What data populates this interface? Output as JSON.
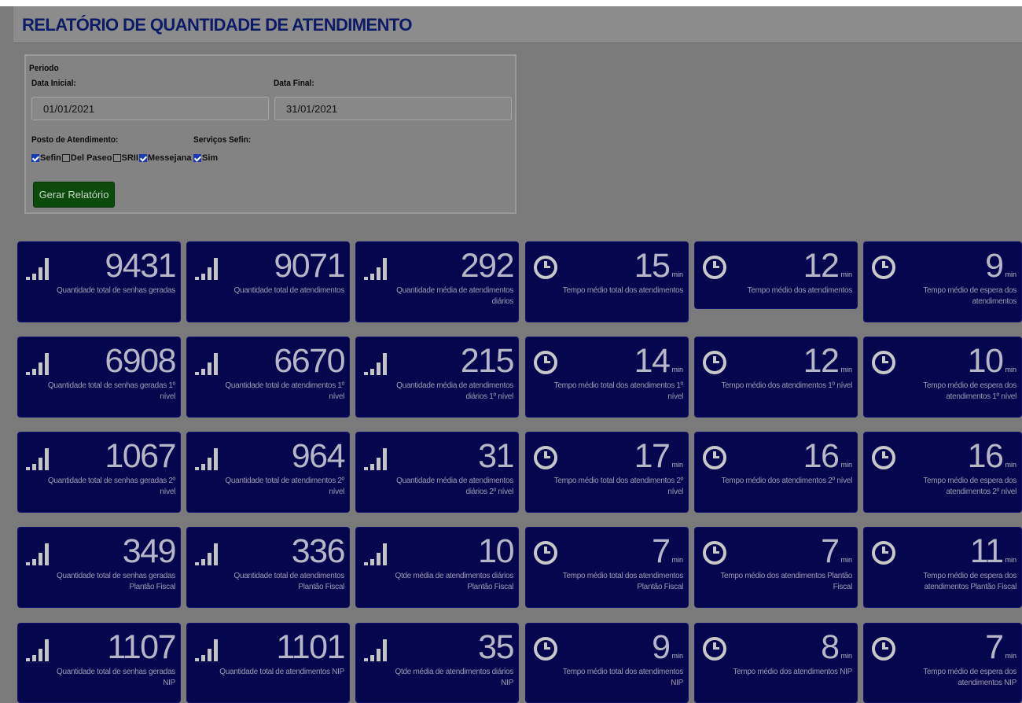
{
  "title": "RELATÓRIO DE QUANTIDADE DE ATENDIMENTO",
  "filters": {
    "period_label": "Periodo",
    "start_label": "Data Inicial:",
    "start_value": "01/01/2021",
    "end_label": "Data Final:",
    "end_value": "31/01/2021",
    "posto_label": "Posto de Atendimento:",
    "postos": [
      {
        "label": "Sefin",
        "checked": true
      },
      {
        "label": "Del Paseo",
        "checked": false
      },
      {
        "label": "SRII",
        "checked": false
      },
      {
        "label": "Messejana",
        "checked": true
      }
    ],
    "servicos_label": "Serviços Sefin:",
    "servicos": [
      {
        "label": "Sim",
        "checked": true
      }
    ],
    "submit_label": "Gerar Relatório"
  },
  "unit": "min",
  "cards": [
    [
      {
        "icon": "bar-chart-icon",
        "value": "9431",
        "desc": "Quantidade total de senhas geradas"
      },
      {
        "icon": "bar-chart-icon",
        "value": "9071",
        "desc": "Quantidade total de atendimentos"
      },
      {
        "icon": "bar-chart-icon",
        "value": "292",
        "desc": "Quantidade média de atendimentos diários"
      },
      {
        "icon": "clock-icon",
        "value": "15",
        "desc": "Tempo médio total dos atendimentos"
      },
      {
        "icon": "clock-icon",
        "value": "12",
        "desc": "Tempo médio dos atendimentos"
      },
      {
        "icon": "clock-icon",
        "value": "9",
        "desc": "Tempo médio de espera dos atendimentos"
      }
    ],
    [
      {
        "icon": "bar-chart-icon",
        "value": "6908",
        "desc": "Quantidade total de senhas geradas 1º nível"
      },
      {
        "icon": "bar-chart-icon",
        "value": "6670",
        "desc": "Quantidade total de atendimentos 1º nível"
      },
      {
        "icon": "bar-chart-icon",
        "value": "215",
        "desc": "Quantidade média de atendimentos diários 1º nível"
      },
      {
        "icon": "clock-icon",
        "value": "14",
        "desc": "Tempo médio total dos atendimentos 1º nível"
      },
      {
        "icon": "clock-icon",
        "value": "12",
        "desc": "Tempo médio dos atendimentos 1º nível"
      },
      {
        "icon": "clock-icon",
        "value": "10",
        "desc": "Tempo médio de espera dos atendimentos 1º nível"
      }
    ],
    [
      {
        "icon": "bar-chart-icon",
        "value": "1067",
        "desc": "Quantidade total de senhas geradas 2º nível"
      },
      {
        "icon": "bar-chart-icon",
        "value": "964",
        "desc": "Quantidade total de atendimentos 2º nível"
      },
      {
        "icon": "bar-chart-icon",
        "value": "31",
        "desc": "Quantidade média de atendimentos diários 2º nível"
      },
      {
        "icon": "clock-icon",
        "value": "17",
        "desc": "Tempo médio total dos atendimentos 2º nível"
      },
      {
        "icon": "clock-icon",
        "value": "16",
        "desc": "Tempo médio dos atendimentos 2º nível"
      },
      {
        "icon": "clock-icon",
        "value": "16",
        "desc": "Tempo médio de espera dos atendimentos 2º nível"
      }
    ],
    [
      {
        "icon": "bar-chart-icon",
        "value": "349",
        "desc": "Quantidade total de senhas geradas Plantão Fiscal"
      },
      {
        "icon": "bar-chart-icon",
        "value": "336",
        "desc": "Quantidade total de atendimentos Plantão Fiscal"
      },
      {
        "icon": "bar-chart-icon",
        "value": "10",
        "desc": "Qtde média de atendimentos diários Plantão Fiscal"
      },
      {
        "icon": "clock-icon",
        "value": "7",
        "desc": "Tempo médio total dos atendimentos Plantão Fiscal"
      },
      {
        "icon": "clock-icon",
        "value": "7",
        "desc": "Tempo médio dos atendimentos Plantão Fiscal"
      },
      {
        "icon": "clock-icon",
        "value": "11",
        "desc": "Tempo médio de espera dos atendimentos Plantão Fiscal"
      }
    ],
    [
      {
        "icon": "bar-chart-icon",
        "value": "1107",
        "desc": "Quantidade total de senhas geradas NIP"
      },
      {
        "icon": "bar-chart-icon",
        "value": "1101",
        "desc": "Quantidade total de atendimentos NIP"
      },
      {
        "icon": "bar-chart-icon",
        "value": "35",
        "desc": "Qtde média de atendimentos diários NIP"
      },
      {
        "icon": "clock-icon",
        "value": "9",
        "desc": "Tempo médio total dos atendimentos NIP"
      },
      {
        "icon": "clock-icon",
        "value": "8",
        "desc": "Tempo médio dos atendimentos NIP"
      },
      {
        "icon": "clock-icon",
        "value": "7",
        "desc": "Tempo médio de espera dos atendimentos NIP"
      }
    ]
  ]
}
